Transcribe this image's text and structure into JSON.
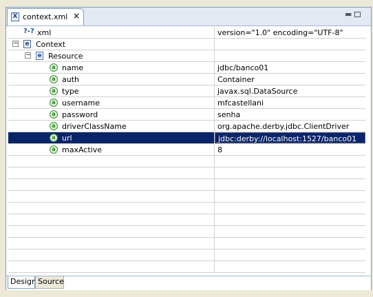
{
  "editor": {
    "tab_title": "context.xml",
    "tab_icon": "X",
    "close_glyph": "×"
  },
  "tree": {
    "rows": [
      {
        "label": "xml",
        "value": "version=\"1.0\" encoding=\"UTF-8\"",
        "icon": "?-?"
      },
      {
        "label": "Context",
        "value": "",
        "icon": "e",
        "expander": "−"
      },
      {
        "label": "Resource",
        "value": "",
        "icon": "e",
        "expander": "−"
      },
      {
        "label": "name",
        "value": "jdbc/banco01",
        "icon": "a"
      },
      {
        "label": "auth",
        "value": "Container",
        "icon": "a"
      },
      {
        "label": "type",
        "value": "javax.sql.DataSource",
        "icon": "a"
      },
      {
        "label": "username",
        "value": "mfcastellani",
        "icon": "a"
      },
      {
        "label": "password",
        "value": "senha",
        "icon": "a"
      },
      {
        "label": "driverClassName",
        "value": "org.apache.derby.jdbc.ClientDriver",
        "icon": "a"
      },
      {
        "label": "url",
        "value": "jdbc:derby://localhost:1527/banco01",
        "icon": "a",
        "selected": true
      },
      {
        "label": "maxActive",
        "value": "8",
        "icon": "a"
      }
    ]
  },
  "bottom_tabs": {
    "design": "Design",
    "source": "Source"
  },
  "colors": {
    "selection": "#0a246a",
    "tab_border": "#7f9db9"
  }
}
